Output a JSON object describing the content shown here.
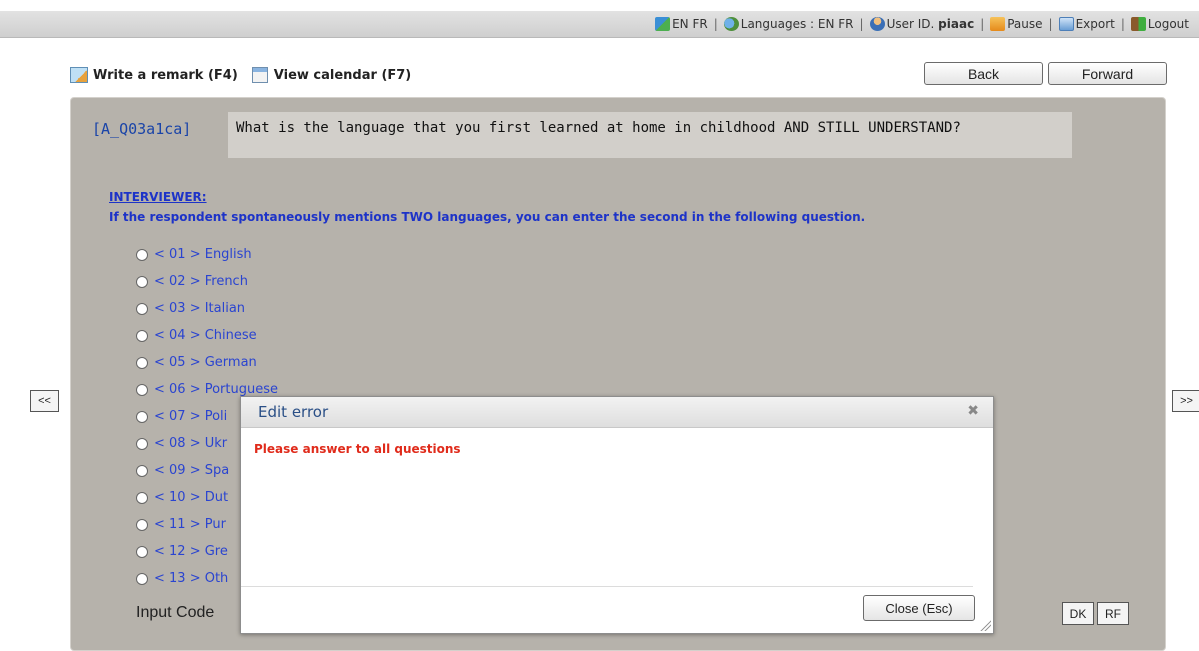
{
  "topbar": {
    "lang_switch": "EN FR",
    "languages_label": "Languages : EN FR",
    "user_label": "User ID.",
    "user_id": "piaac",
    "pause": "Pause",
    "export": "Export",
    "logout": "Logout",
    "separator": "|"
  },
  "actions": {
    "remark": "Write a remark (F4)",
    "calendar": "View calendar (F7)",
    "back": "Back",
    "forward": "Forward"
  },
  "question": {
    "id": "[A_Q03a1ca]",
    "text": "What is the language that you first learned at home in childhood AND STILL UNDERSTAND?",
    "interviewer_label": "INTERVIEWER:",
    "interviewer_note": "If the respondent spontaneously mentions TWO languages, you can enter the second in the following question."
  },
  "options": [
    {
      "label": "< 01 > English"
    },
    {
      "label": "< 02 > French"
    },
    {
      "label": "< 03 > Italian"
    },
    {
      "label": "< 04 > Chinese"
    },
    {
      "label": "< 05 > German"
    },
    {
      "label": "< 06 > Portuguese"
    },
    {
      "label": "< 07 > Poli"
    },
    {
      "label": "< 08 > Ukr"
    },
    {
      "label": "< 09 > Spa"
    },
    {
      "label": "< 10 > Dut"
    },
    {
      "label": "< 11 > Pur"
    },
    {
      "label": "< 12 > Gre"
    },
    {
      "label": "< 13 > Oth"
    }
  ],
  "input_code_label": "Input Code",
  "buttons": {
    "dk": "DK",
    "rf": "RF",
    "prev": "<<",
    "next": ">>"
  },
  "dialog": {
    "title": "Edit error",
    "close_icon": "✖",
    "message": "Please answer to all questions",
    "close_button": "Close (Esc)"
  }
}
